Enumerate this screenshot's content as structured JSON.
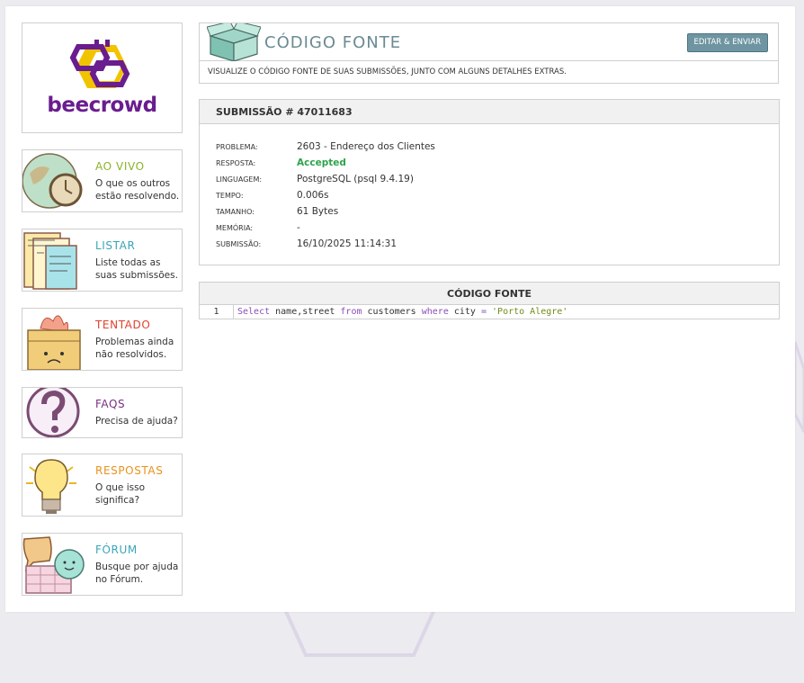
{
  "brand": {
    "logo_text": "beecrowd",
    "logo_color": "#6a1d8e",
    "accent_yellow": "#f2c300"
  },
  "sidebar": {
    "items": [
      {
        "title": "AO VIVO",
        "desc": "O que os outros estão resolvendo.",
        "color": "#8ab22b",
        "icon": "globe-clock-icon"
      },
      {
        "title": "LISTAR",
        "desc": "Liste todas as suas submissões.",
        "color": "#3aa5b8",
        "icon": "documents-icon"
      },
      {
        "title": "TENTADO",
        "desc": "Problemas ainda não resolvidos.",
        "color": "#e0412c",
        "icon": "burning-box-icon"
      },
      {
        "title": "FAQS",
        "desc": "Precisa de ajuda?",
        "color": "#7b2f7f",
        "icon": "question-icon"
      },
      {
        "title": "RESPOSTAS",
        "desc": "O que isso significa?",
        "color": "#e8921c",
        "icon": "lightbulb-icon"
      },
      {
        "title": "FÓRUM",
        "desc": "Busque por ajuda no Fórum.",
        "color": "#3aa5b8",
        "icon": "chat-icon"
      }
    ]
  },
  "header": {
    "title": "CÓDIGO FONTE",
    "button_label": "EDITAR & ENVIAR",
    "subtitle": "VISUALIZE O CÓDIGO FONTE DE SUAS SUBMISSÕES, JUNTO COM ALGUNS DETALHES EXTRAS."
  },
  "submission": {
    "heading": "SUBMISSÃO # 47011683",
    "fields": [
      {
        "key": "PROBLEMA:",
        "value": "2603 - Endereço dos Clientes"
      },
      {
        "key": "RESPOSTA:",
        "value": "Accepted"
      },
      {
        "key": "LINGUAGEM:",
        "value": "PostgreSQL (psql 9.4.19)"
      },
      {
        "key": "TEMPO:",
        "value": "0.006s"
      },
      {
        "key": "TAMANHO:",
        "value": "61 Bytes"
      },
      {
        "key": "MEMÓRIA:",
        "value": "-"
      },
      {
        "key": "SUBMISSÃO:",
        "value": "16/10/2025 11:14:31"
      }
    ]
  },
  "code": {
    "heading": "CÓDIGO FONTE",
    "line_number": "1",
    "tokens": {
      "kw1": "Select",
      "t1": " name,street ",
      "kw2": "from",
      "t2": " customers ",
      "kw3": "where",
      "t3": " city ",
      "op": "=",
      "t4": " ",
      "str": "'Porto Alegre'"
    }
  }
}
